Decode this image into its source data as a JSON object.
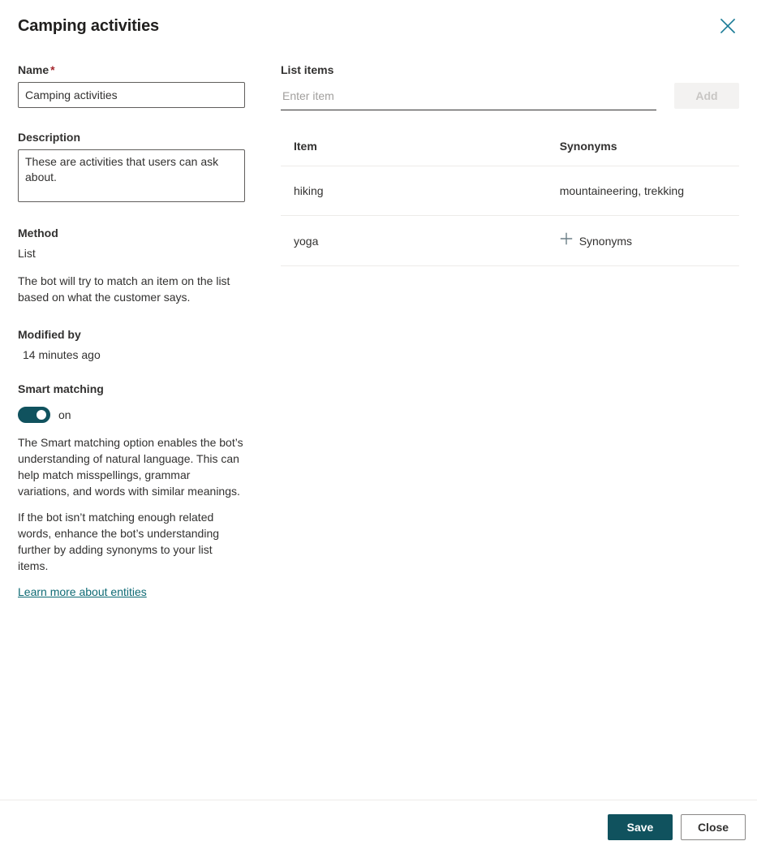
{
  "header": {
    "title": "Camping activities",
    "close_icon": "close-icon"
  },
  "left": {
    "name": {
      "label": "Name",
      "required_marker": "*",
      "value": "Camping activities"
    },
    "description": {
      "label": "Description",
      "value": "These are activities that users can ask about."
    },
    "method": {
      "label": "Method",
      "value": "List",
      "help": "The bot will try to match an item on the list based on what the customer says."
    },
    "modified": {
      "label": "Modified by",
      "value": "14 minutes ago"
    },
    "smart_matching": {
      "label": "Smart matching",
      "toggle_state": "on",
      "toggle_on": true,
      "help_1": "The Smart matching option enables the bot’s understanding of natural language. This can help match misspellings, grammar variations, and words with similar meanings.",
      "help_2": "If the bot isn’t matching enough related words, enhance the bot’s understanding further by adding synonyms to your list items.",
      "learn_more": "Learn more about entities"
    }
  },
  "right": {
    "list_items_label": "List items",
    "add_input_placeholder": "Enter item",
    "add_input_value": "",
    "add_button_label": "Add",
    "add_button_disabled": true,
    "table": {
      "columns": [
        "Item",
        "Synonyms"
      ],
      "rows": [
        {
          "item": "hiking",
          "synonyms": "mountaineering, trekking",
          "has_synonyms": true
        },
        {
          "item": "yoga",
          "synonyms": "Synonyms",
          "has_synonyms": false
        }
      ]
    }
  },
  "footer": {
    "save_label": "Save",
    "close_label": "Close"
  },
  "colors": {
    "accent": "#10525e",
    "link": "#0f6b75",
    "close_icon": "#1a7b96",
    "required": "#a4262c",
    "divider": "#edebe9",
    "plus_icon": "#6b7f87"
  }
}
